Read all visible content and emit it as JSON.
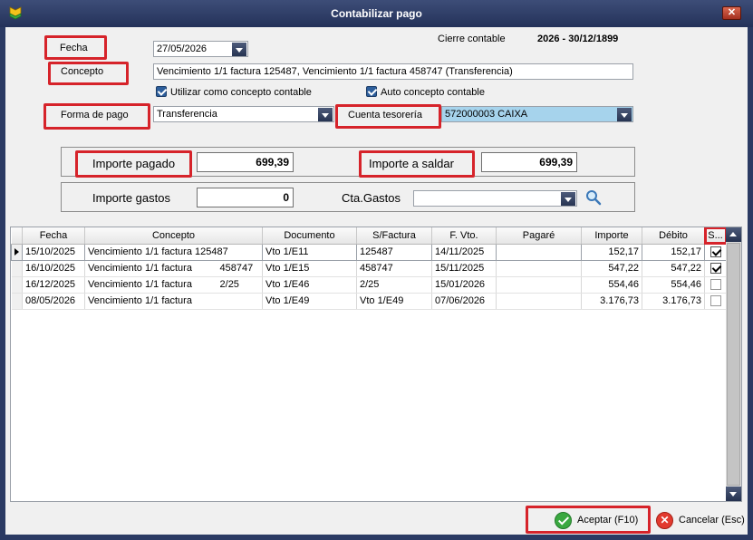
{
  "window": {
    "title": "Contabilizar pago",
    "close_glyph": "✕"
  },
  "form": {
    "fecha_label": "Fecha",
    "fecha_value": "27/05/2026",
    "cierre_label": "Cierre contable",
    "cierre_value": "2026 - 30/12/1899",
    "concepto_label": "Concepto",
    "concepto_value": "Vencimiento 1/1 factura 125487, Vencimiento 1/1 factura         458747 (Transferencia)",
    "usar_concepto_label": "Utilizar como concepto contable",
    "auto_concepto_label": "Auto concepto contable",
    "forma_pago_label": "Forma de pago",
    "forma_pago_value": "Transferencia",
    "cuenta_label": "Cuenta tesorería",
    "cuenta_value": "572000003 CAIXA"
  },
  "importes": {
    "pagado_label": "Importe pagado",
    "pagado_value": "699,39",
    "saldar_label": "Importe a saldar",
    "saldar_value": "699,39",
    "gastos_label": "Importe gastos",
    "gastos_value": "0",
    "cta_gastos_label": "Cta.Gastos",
    "cta_gastos_value": ""
  },
  "table": {
    "columns": [
      "Fecha",
      "Concepto",
      "Documento",
      "S/Factura",
      "F. Vto.",
      "Pagaré",
      "Importe",
      "Débito",
      "S..."
    ],
    "rows": [
      {
        "fecha": "15/10/2025",
        "concepto": "Vencimiento 1/1 factura 125487",
        "documento": "Vto 1/E11",
        "sfactura": "125487",
        "fvto": "14/11/2025",
        "pagare": "",
        "importe": "152,17",
        "debito": "152,17",
        "selected": true
      },
      {
        "fecha": "16/10/2025",
        "concepto": "Vencimiento 1/1 factura          458747",
        "documento": "Vto 1/E15",
        "sfactura": "458747",
        "fvto": "15/11/2025",
        "pagare": "",
        "importe": "547,22",
        "debito": "547,22",
        "selected": true
      },
      {
        "fecha": "16/12/2025",
        "concepto": "Vencimiento 1/1 factura          2/25",
        "documento": "Vto 1/E46",
        "sfactura": "2/25",
        "fvto": "15/01/2026",
        "pagare": "",
        "importe": "554,46",
        "debito": "554,46",
        "selected": false
      },
      {
        "fecha": "08/05/2026",
        "concepto": "Vencimiento 1/1 factura",
        "documento": "Vto 1/E49",
        "sfactura": "Vto 1/E49",
        "fvto": "07/06/2026",
        "pagare": "",
        "importe": "3.176,73",
        "debito": "3.176,73",
        "selected": false
      }
    ]
  },
  "buttons": {
    "aceptar": "Aceptar (F10)",
    "cancelar": "Cancelar (Esc)",
    "cancel_glyph": "✕"
  },
  "colors": {
    "highlight_red": "#d6232a",
    "title_bar": "#2b3a63",
    "account_field": "#a6d3ec"
  }
}
